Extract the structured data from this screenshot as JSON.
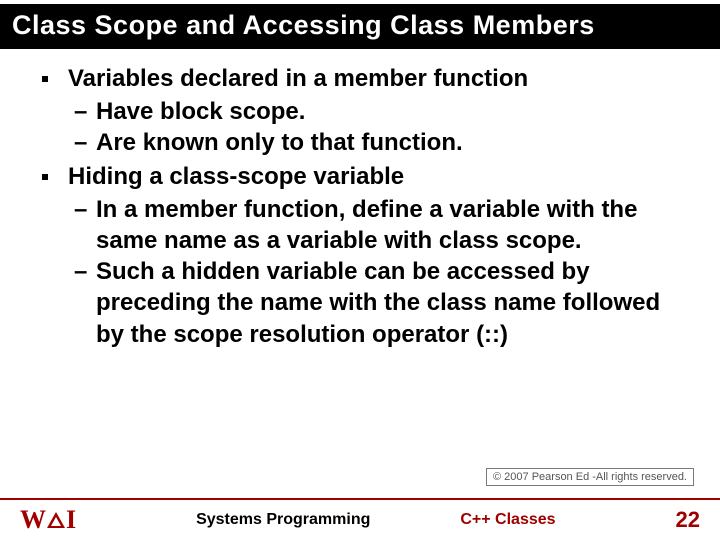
{
  "title": "Class Scope and Accessing Class Members",
  "bullets": [
    {
      "text": "Variables declared in a member function",
      "subs": [
        "Have block scope.",
        "Are known only to that function."
      ]
    },
    {
      "text": "Hiding a class-scope variable",
      "subs": [
        "In a member function, define a variable with the same name as a variable with class scope.",
        "Such a hidden variable can be accessed by preceding the name with the class name followed by the scope resolution operator (::)"
      ]
    }
  ],
  "copyright": "© 2007 Pearson Ed -All rights reserved.",
  "footer": {
    "course": "Systems Programming",
    "topic": "C++ Classes",
    "page": "22"
  },
  "logo": {
    "w": "W",
    "i": "I"
  }
}
